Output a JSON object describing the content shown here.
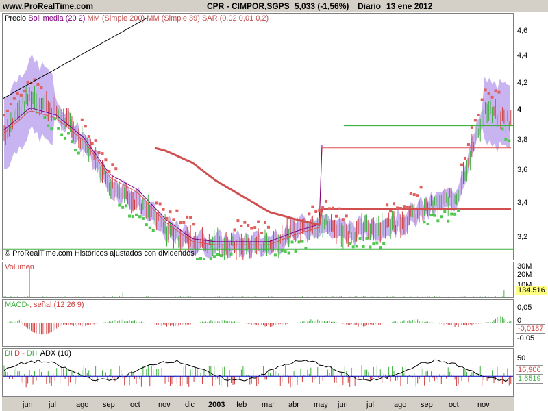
{
  "header": {
    "site": "www.ProRealTime.com",
    "instrument": "CPR - CIMPOR,SGPS",
    "quote": "5,033 (-1,56%)",
    "period": "Diario",
    "date": "13 ene 2012"
  },
  "legend": {
    "price": "Precio",
    "boll": "Boll media (20 2)",
    "ma200": "MM (Simple 200)",
    "ma39": "MM (Simple 39)",
    "sar": "SAR (0,02 0,01 0,2)"
  },
  "footnote": "© ProRealTime.com  Históricos ajustados con dividendos",
  "volume_panel": {
    "title": "Volumen",
    "value_tag": "134.516"
  },
  "macd_panel": {
    "title_a": "MACD-",
    "title_b": ", señal (12 26 9)",
    "value_tag": "-0,0187"
  },
  "adx_panel": {
    "title_a": "DI",
    "title_b": "DI-",
    "title_c": "DI+",
    "title_d": "ADX (10)",
    "tag_1": "16,906",
    "tag_2": "1,6519"
  },
  "scale_labels": {
    "price": [
      "4,6",
      "4,4",
      "4,2",
      "4",
      "3,8",
      "3,6",
      "3,4",
      "3,2"
    ],
    "price_highlight": "4",
    "volume": [
      "30M",
      "20M",
      "10M"
    ],
    "macd": [
      "0,05",
      "0",
      "-0,05"
    ],
    "adx": [
      "50"
    ]
  },
  "colors": {
    "panel_bg": "#d4d0c8",
    "boll_band": "#c8b4f0",
    "sar": "#e06060",
    "sar_up": "#50c850",
    "ma200": "#d05050",
    "ma39": "#e05050",
    "boll_mid": "#800080",
    "hline": "#40b040",
    "trendline": "#000000",
    "volume_bar": "#40b040",
    "value_tag_bg": "#ffff80"
  },
  "chart_data": {
    "type": "line",
    "x_ticks": [
      "jun",
      "jul",
      "ago",
      "sep",
      "oct",
      "nov",
      "dic",
      "2003",
      "feb",
      "mar",
      "abr",
      "may",
      "jun",
      "jul",
      "ago",
      "sep",
      "oct",
      "nov"
    ],
    "y_range": [
      3.1,
      4.75
    ],
    "series": [
      {
        "name": "Precio",
        "x": [
          "jun",
          "jul",
          "ago",
          "sep",
          "oct",
          "nov",
          "dic",
          "2003",
          "feb",
          "mar",
          "abr",
          "may",
          "jun",
          "jul",
          "ago",
          "sep",
          "oct",
          "nov"
        ],
        "values": [
          4.2,
          4.1,
          3.9,
          3.6,
          3.5,
          3.3,
          3.22,
          3.2,
          3.2,
          3.2,
          3.3,
          3.35,
          3.28,
          3.32,
          3.35,
          3.45,
          3.52,
          4.1
        ]
      },
      {
        "name": "MM (Simple 200)",
        "x": [
          "oct",
          "nov",
          "dic",
          "2003",
          "feb",
          "mar",
          "abr",
          "may",
          "jun",
          "jul",
          "ago",
          "sep",
          "oct",
          "nov"
        ],
        "values": [
          3.88,
          3.83,
          3.75,
          3.63,
          3.52,
          3.42,
          3.37,
          3.33,
          3.31,
          3.29,
          3.28,
          3.29,
          3.34,
          3.44
        ]
      },
      {
        "name": "MM (Simple 39)",
        "x": [
          "jun",
          "jul",
          "ago",
          "sep",
          "oct",
          "nov",
          "dic",
          "2003",
          "feb",
          "mar",
          "abr",
          "may",
          "jun",
          "jul",
          "ago",
          "sep",
          "oct",
          "nov"
        ],
        "values": [
          4.1,
          4.05,
          3.9,
          3.65,
          3.55,
          3.35,
          3.22,
          3.2,
          3.2,
          3.2,
          3.27,
          3.32,
          3.3,
          3.31,
          3.35,
          3.43,
          3.5,
          3.85
        ]
      }
    ],
    "hlines": [
      4.0,
      3.17
    ],
    "volume_ylim": [
      0,
      30
    ],
    "macd_ylim": [
      -0.07,
      0.07
    ],
    "adx_ylim": [
      0,
      60
    ],
    "grid": false,
    "legend": "top-left"
  }
}
